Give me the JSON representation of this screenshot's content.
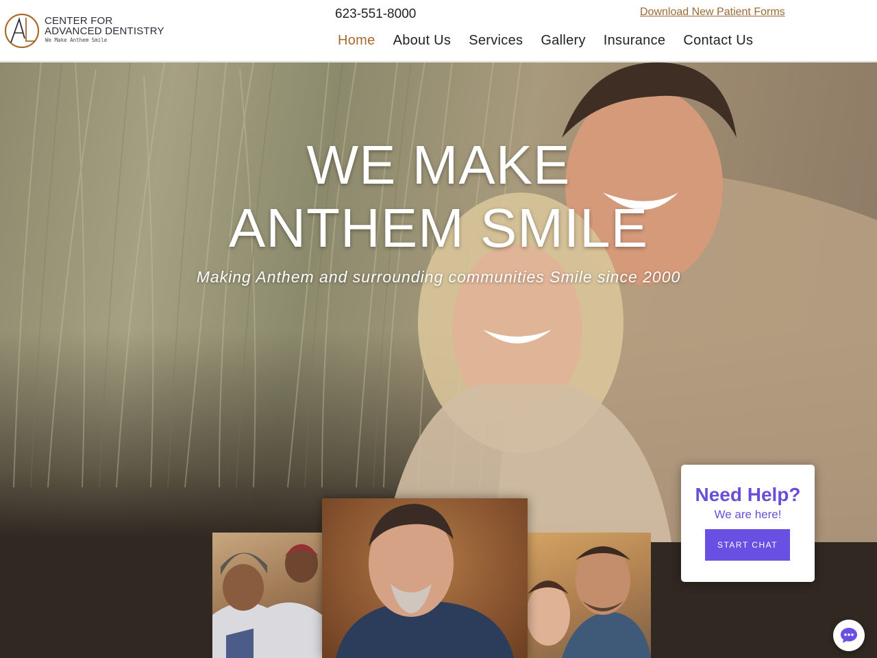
{
  "brand": {
    "line1": "CENTER FOR",
    "line2": "ADVANCED DENTISTRY",
    "tagline": "We Make Anthem Smile",
    "logo_icon": "ad-monogram-logo",
    "accent_color": "#a86a2c"
  },
  "header": {
    "phone": "623-551-8000",
    "forms_link": "Download New Patient Forms"
  },
  "nav": {
    "items": [
      {
        "label": "Home",
        "active": true
      },
      {
        "label": "About Us",
        "active": false
      },
      {
        "label": "Services",
        "active": false
      },
      {
        "label": "Gallery",
        "active": false
      },
      {
        "label": "Insurance",
        "active": false
      },
      {
        "label": "Contact Us",
        "active": false
      }
    ]
  },
  "hero": {
    "title_line1": "WE MAKE",
    "title_line2": "ANTHEM SMILE",
    "subtitle": "Making Anthem and surrounding communities Smile since 2000"
  },
  "help_widget": {
    "title": "Need Help?",
    "subtitle": "We are here!",
    "button": "START CHAT",
    "color": "#6a4fe3"
  },
  "chat": {
    "icon": "chat-bubble-icon"
  }
}
